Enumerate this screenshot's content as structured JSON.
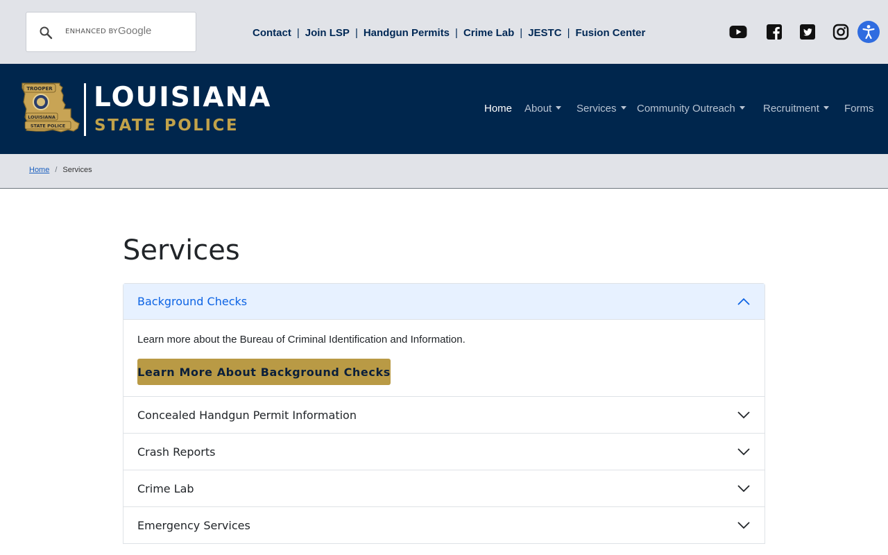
{
  "search": {
    "enhanced_by": "ENHANCED BY",
    "google": "Google",
    "placeholder": ""
  },
  "utility_links": [
    "Contact",
    "Join LSP",
    "Handgun Permits",
    "Crime Lab",
    "JESTC",
    "Fusion Center"
  ],
  "utility_separator": "|",
  "social_icons": [
    "youtube-icon",
    "facebook-icon",
    "twitter-icon",
    "instagram-icon",
    "accessibility-icon"
  ],
  "logo": {
    "line1": "LOUISIANA",
    "line2": "STATE POLICE",
    "badge_top": "TROOPER",
    "badge_mid": "LOUISIANA",
    "badge_bottom": "STATE POLICE"
  },
  "nav": {
    "home": "Home",
    "about": "About",
    "services": "Services",
    "community": "Community Outreach",
    "recruitment": "Recruitment",
    "forms": "Forms"
  },
  "breadcrumb": {
    "home": "Home",
    "separator": "/",
    "current": "Services"
  },
  "page_title": "Services",
  "accordion": {
    "open_item": {
      "title": "Background Checks",
      "body": "Learn more about the Bureau of Criminal Identification and Information.",
      "button": "Learn More About Background Checks"
    },
    "items": [
      "Concealed Handgun Permit Information",
      "Crash Reports",
      "Crime Lab",
      "Emergency Services"
    ]
  },
  "colors": {
    "navy": "#00264d",
    "gold": "#c1a24a",
    "button_gold": "#b99a45",
    "util_bg": "#e1e3e8",
    "accent_blue": "#0c63e4",
    "a11y_blue": "#2f6ce0"
  }
}
